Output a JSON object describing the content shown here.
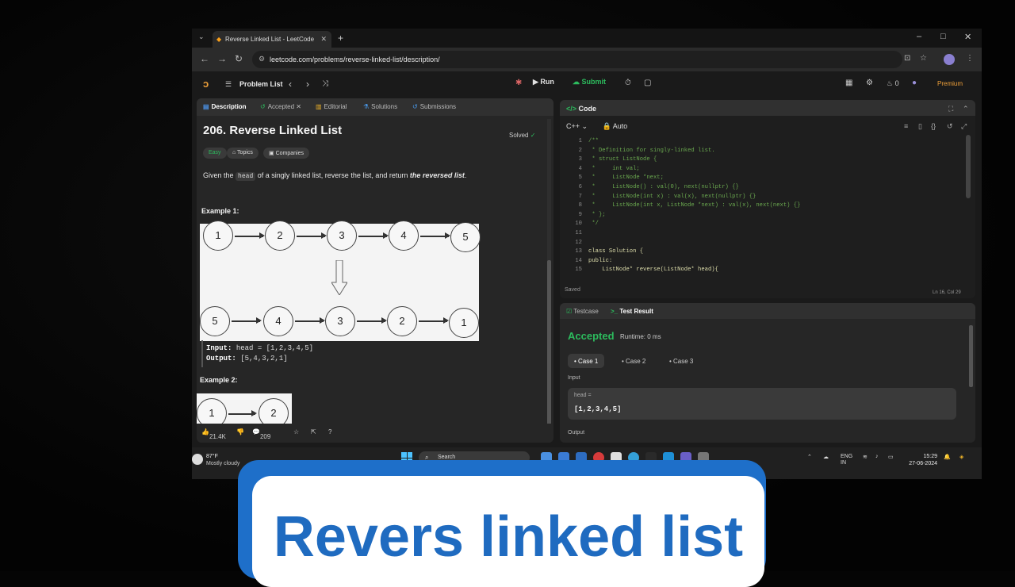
{
  "browser": {
    "tab_title": "Reverse Linked List - LeetCode",
    "url": "leetcode.com/problems/reverse-linked-list/description/"
  },
  "lc_nav": {
    "problem_list": "Problem List",
    "run": "Run",
    "submit": "Submit",
    "coins": "0",
    "premium": "Premium"
  },
  "left_tabs": [
    "Description",
    "Accepted",
    "Editorial",
    "Solutions",
    "Submissions"
  ],
  "problem": {
    "title": "206. Reverse Linked List",
    "status": "Solved",
    "difficulty": "Easy",
    "topics": "Topics",
    "companies": "Companies",
    "desc_pre": "Given the",
    "desc_code": "head",
    "desc_mid": "of a singly linked list, reverse the list, and return",
    "desc_em": "the reversed list",
    "desc_end": ".",
    "example1": "Example 1:",
    "example2": "Example 2:",
    "top_nodes": [
      "1",
      "2",
      "3",
      "4",
      "5"
    ],
    "bottom_nodes": [
      "5",
      "4",
      "3",
      "2",
      "1"
    ],
    "ex2_nodes": [
      "1",
      "2"
    ],
    "input_label": "Input:",
    "input_value": "head = [1,2,3,4,5]",
    "output_label": "Output:",
    "output_value": "[5,4,3,2,1]"
  },
  "footer_stats": {
    "likes": "21.4K",
    "comments": "209"
  },
  "code_panel": {
    "title": "Code",
    "language": "C++",
    "mode": "Auto",
    "saved": "Saved",
    "cursor": "Ln 16, Col 29",
    "lines": [
      {
        "n": "1",
        "t": "/**"
      },
      {
        "n": "2",
        "t": " * Definition for singly-linked list."
      },
      {
        "n": "3",
        "t": " * struct ListNode {"
      },
      {
        "n": "4",
        "t": " *     int val;"
      },
      {
        "n": "5",
        "t": " *     ListNode *next;"
      },
      {
        "n": "6",
        "t": " *     ListNode() : val(0), next(nullptr) {}"
      },
      {
        "n": "7",
        "t": " *     ListNode(int x) : val(x), next(nullptr) {}"
      },
      {
        "n": "8",
        "t": " *     ListNode(int x, ListNode *next) : val(x), next(next) {}"
      },
      {
        "n": "9",
        "t": " * };"
      },
      {
        "n": "10",
        "t": " */"
      },
      {
        "n": "11",
        "t": ""
      },
      {
        "n": "12",
        "t": ""
      },
      {
        "n": "13",
        "t": "class Solution {"
      },
      {
        "n": "14",
        "t": "public:"
      },
      {
        "n": "15",
        "t": "    ListNode* reverse(ListNode* head){"
      }
    ]
  },
  "result_panel": {
    "tabs": [
      "Testcase",
      "Test Result"
    ],
    "status": "Accepted",
    "runtime": "Runtime: 0 ms",
    "cases": [
      "Case 1",
      "Case 2",
      "Case 3"
    ],
    "input_label": "Input",
    "input_key": "head =",
    "input_value": "[1,2,3,4,5]",
    "output_label": "Output"
  },
  "taskbar": {
    "temp": "87°F",
    "weather": "Mostly cloudy",
    "search": "Search",
    "lang_top": "ENG",
    "lang_bottom": "IN",
    "time": "15:29",
    "date": "27-06-2024"
  },
  "caption": "Revers linked list"
}
